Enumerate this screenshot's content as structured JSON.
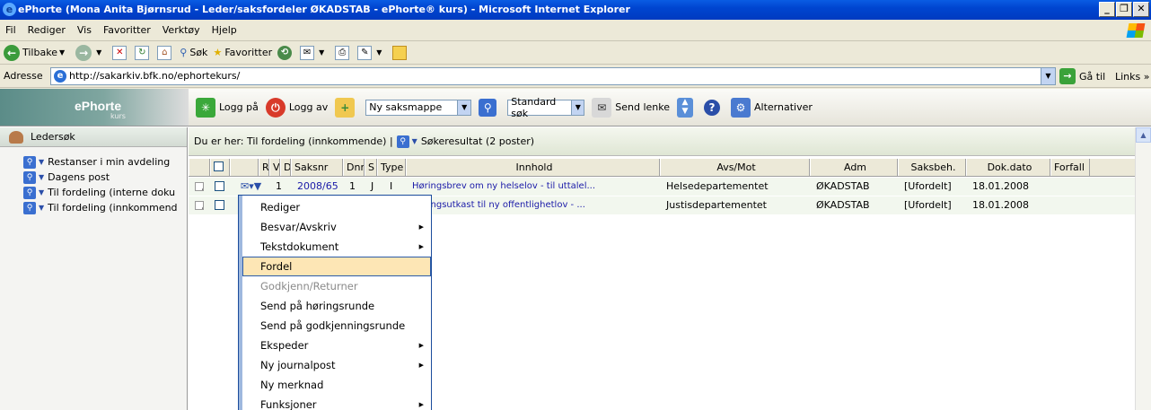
{
  "window": {
    "title": "ePhorte (Mona Anita Bjørnsrud - Leder/saksfordeler ØKADSTAB - ePhorte® kurs) - Microsoft Internet Explorer",
    "min": "_",
    "max": "❐",
    "close": "✕"
  },
  "menubar": [
    "Fil",
    "Rediger",
    "Vis",
    "Favoritter",
    "Verktøy",
    "Hjelp"
  ],
  "ie_toolbar": {
    "back": "Tilbake",
    "search": "Søk",
    "favorites": "Favoritter"
  },
  "address": {
    "label": "Adresse",
    "url": "http://sakarkiv.bfk.no/ephortekurs/",
    "go": "Gå til",
    "links": "Links"
  },
  "logo": {
    "title": "ePhorte",
    "sub": "kurs"
  },
  "app_toolbar": {
    "login": "Logg på",
    "logout": "Logg av",
    "new_folder_select": "Ny saksmappe",
    "search_select": "Standard søk",
    "send_link": "Send lenke",
    "options": "Alternativer"
  },
  "left_panel": {
    "title": "Ledersøk",
    "items": [
      "Restanser i min avdeling",
      "Dagens post",
      "Til fordeling (interne doku",
      "Til fordeling (innkommend"
    ]
  },
  "breadcrumb": {
    "prefix": "Du er her: Til fordeling (innkommende) |",
    "result": "Søkeresultat (2 poster)"
  },
  "columns": [
    "R",
    "V",
    "D",
    "Saksnr",
    "Dnr",
    "S",
    "Type",
    "Innhold",
    "Avs/Mot",
    "Adm",
    "Saksbeh.",
    "Dok.dato",
    "Forfall"
  ],
  "rows": [
    {
      "v": "1",
      "saksnr": "2008/65",
      "dnr": "1",
      "s": "J",
      "type": "I",
      "innhold": "Høringsbrev om ny helselov - til uttalel...",
      "avs": "Helsedepartementet",
      "adm": "ØKADSTAB",
      "saksbeh": "[Ufordelt]",
      "dato": "18.01.2008"
    },
    {
      "v": "",
      "saksnr": "",
      "dnr": "",
      "s": "",
      "type": "",
      "innhold": "Høringsutkast til ny offentlighetlov - ...",
      "avs": "Justisdepartementet",
      "adm": "ØKADSTAB",
      "saksbeh": "[Ufordelt]",
      "dato": "18.01.2008"
    }
  ],
  "context_menu": [
    {
      "label": "Rediger",
      "submenu": false
    },
    {
      "label": "Besvar/Avskriv",
      "submenu": true
    },
    {
      "label": "Tekstdokument",
      "submenu": true
    },
    {
      "label": "Fordel",
      "submenu": false,
      "highlighted": true
    },
    {
      "label": "Godkjenn/Returner",
      "submenu": false,
      "disabled": true
    },
    {
      "label": "Send på høringsrunde",
      "submenu": false
    },
    {
      "label": "Send på godkjenningsrunde",
      "submenu": false
    },
    {
      "label": "Ekspeder",
      "submenu": true
    },
    {
      "label": "Ny journalpost",
      "submenu": true
    },
    {
      "label": "Ny merknad",
      "submenu": false
    },
    {
      "label": "Funksjoner",
      "submenu": true
    }
  ]
}
